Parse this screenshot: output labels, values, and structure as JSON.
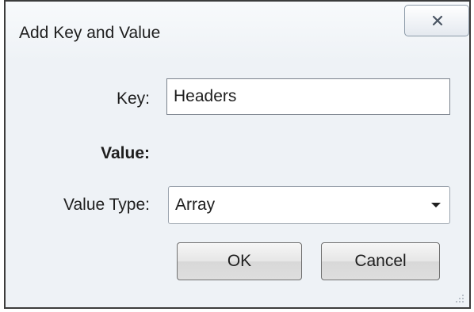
{
  "dialog": {
    "title": "Add Key and Value",
    "close_icon": "close-x-icon"
  },
  "form": {
    "key_label": "Key:",
    "key_value": "Headers",
    "value_label": "Value:",
    "value_type_label": "Value Type:",
    "value_type_selected": "Array",
    "dropdown_icon": "chevron-down-icon"
  },
  "buttons": {
    "ok_label": "OK",
    "cancel_label": "Cancel"
  },
  "colors": {
    "dialog_background": "#eef2f6",
    "border": "#3c3c3c"
  }
}
